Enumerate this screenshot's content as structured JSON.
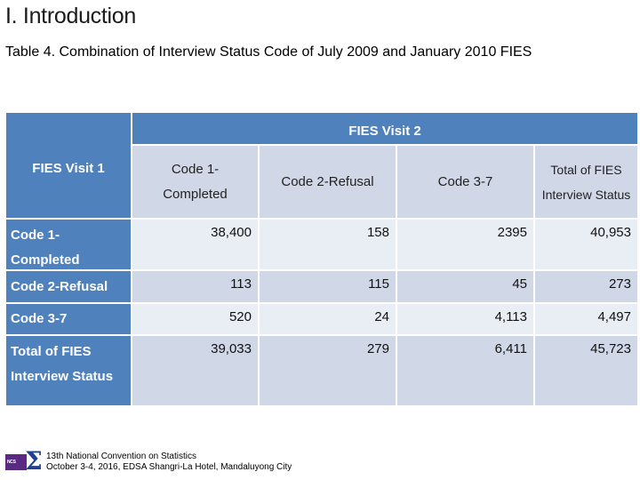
{
  "section_title": "I.  Introduction",
  "table_caption": "Table 4.  Combination of Interview Status Code of July 2009 and January 2010 FIES",
  "table": {
    "row_header_title": "FIES Visit 1",
    "column_group_title": "FIES Visit 2",
    "columns": [
      {
        "line1": "Code 1-",
        "line2": "Completed"
      },
      {
        "line1": "Code 2-Refusal",
        "line2": ""
      },
      {
        "line1": "Code 3-7",
        "line2": ""
      },
      {
        "line1": "Total of FIES",
        "line2": "Interview Status"
      }
    ],
    "rows": [
      {
        "line1": "Code 1-",
        "line2": "Completed",
        "values": [
          "38,400",
          "158",
          "2395",
          "40,953"
        ]
      },
      {
        "line1": "Code 2-Refusal",
        "line2": "",
        "values": [
          "113",
          "115",
          "45",
          "273"
        ]
      },
      {
        "line1": "Code 3-7",
        "line2": "",
        "values": [
          "520",
          "24",
          "4,113",
          "4,497"
        ]
      },
      {
        "line1": "Total of FIES",
        "line2": "Interview Status",
        "values": [
          "39,033",
          "279",
          "6,411",
          "45,723"
        ]
      }
    ]
  },
  "colors": {
    "header_blue": "#4f81bd",
    "band_light": "#e9edf4",
    "band_mid": "#d0d8e8"
  },
  "footer": {
    "logo_icon": "ncs-sigma-logo",
    "logo_text": "NCS",
    "line1": "13th National Convention on Statistics",
    "line2": "October 3-4, 2016, EDSA Shangri-La Hotel, Mandaluyong City"
  }
}
